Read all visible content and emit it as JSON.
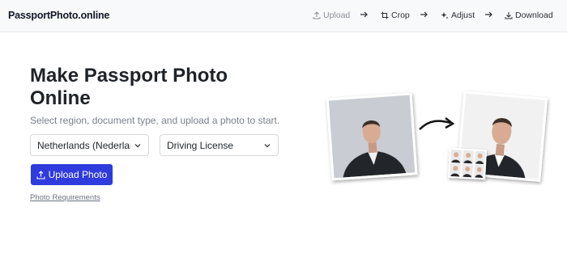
{
  "header": {
    "brand": "PassportPhoto.online",
    "steps": [
      {
        "label": "Upload",
        "icon": "upload-icon",
        "state": "muted"
      },
      {
        "label": "Crop",
        "icon": "crop-icon",
        "state": "active"
      },
      {
        "label": "Adjust",
        "icon": "sparkle-icon",
        "state": "active"
      },
      {
        "label": "Download",
        "icon": "download-icon",
        "state": "active"
      }
    ]
  },
  "main": {
    "title": "Make Passport Photo Online",
    "subtitle": "Select region, document type, and upload a photo to start.",
    "region_select": {
      "value": "Netherlands (Nederland)"
    },
    "document_select": {
      "value": "Driving License"
    },
    "upload_button": "Upload Photo",
    "requirements_link": "Photo Requirements"
  },
  "colors": {
    "accent": "#2f3bdd",
    "header_bg": "#f8f9fa"
  }
}
